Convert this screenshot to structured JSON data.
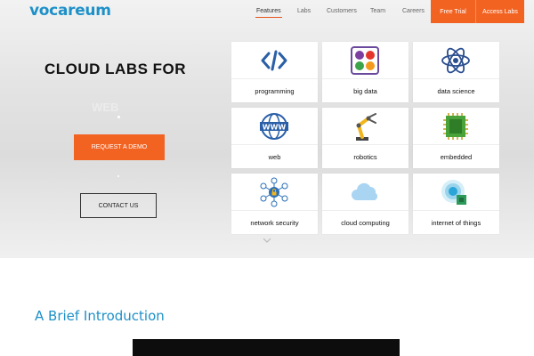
{
  "brand": {
    "logo_text": "vocareum",
    "accent": "#f26322",
    "logo_color": "#1e90c8"
  },
  "nav": {
    "items": [
      {
        "label": "Features",
        "active": true
      },
      {
        "label": "Labs"
      },
      {
        "label": "Customers"
      },
      {
        "label": "Team"
      },
      {
        "label": "Careers"
      }
    ],
    "free_trial": "Free Trial",
    "access_labs": "Access Labs"
  },
  "hero": {
    "title": "CLOUD LABS FOR",
    "rotating_word": "WEB",
    "request_demo": "REQUEST A DEMO",
    "contact_us": "CONTACT US"
  },
  "tiles": [
    {
      "label": "programming",
      "icon": "code-icon"
    },
    {
      "label": "big data",
      "icon": "big-data-icon"
    },
    {
      "label": "data science",
      "icon": "atom-icon"
    },
    {
      "label": "web",
      "icon": "globe-www-icon"
    },
    {
      "label": "robotics",
      "icon": "robot-arm-icon"
    },
    {
      "label": "embedded",
      "icon": "chip-icon"
    },
    {
      "label": "network security",
      "icon": "network-lock-icon"
    },
    {
      "label": "cloud computing",
      "icon": "cloud-icon"
    },
    {
      "label": "internet of things",
      "icon": "iot-signal-icon"
    }
  ],
  "intro": {
    "title": "A Brief Introduction"
  }
}
